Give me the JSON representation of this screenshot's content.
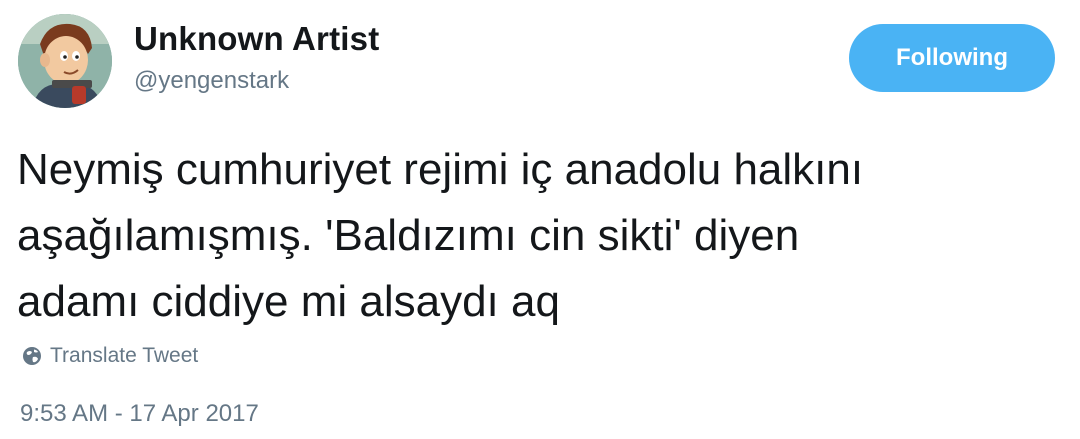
{
  "author": {
    "display_name": "Unknown Artist",
    "handle": "@yengenstark",
    "avatar_icon": "cartoon-avatar"
  },
  "follow_button": {
    "label": "Following",
    "color": "#4ab3f4"
  },
  "tweet": {
    "text": "Neymiş cumhuriyet rejimi iç anadolu halkını\naşağılamışmış.  'Baldızımı cin sikti' diyen\nadamı ciddiye mi alsaydı aq"
  },
  "translate": {
    "label": "Translate Tweet",
    "icon": "globe-icon"
  },
  "timestamp": "9:53 AM - 17 Apr 2017",
  "colors": {
    "text": "#14171a",
    "secondary": "#657786",
    "accent": "#4ab3f4"
  }
}
